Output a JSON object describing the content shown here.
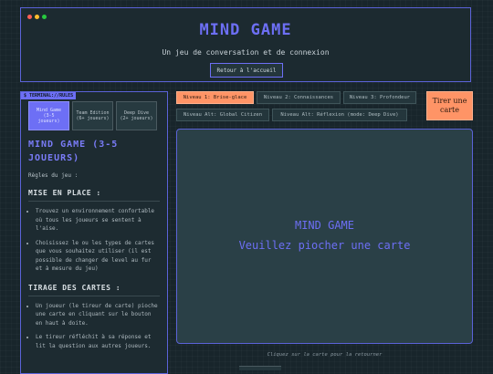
{
  "window": {
    "dots": [
      "#ff5f56",
      "#ffbd2e",
      "#27c93f"
    ]
  },
  "header": {
    "title": "MIND GAME",
    "subtitle": "Un jeu de conversation et de connexion",
    "home_button": "Retour à l'accueil"
  },
  "sidebar": {
    "terminal_label": "$ TERMINAL://RULES",
    "modes": [
      {
        "label": "Mind Game (3-5 joueurs)",
        "active": true
      },
      {
        "label": "Team Edition (6+ joueurs)",
        "active": false
      },
      {
        "label": "Deep Dive (2+ joueurs)",
        "active": false
      }
    ],
    "title": "MIND GAME (3-5 JOUEURS)",
    "rules_intro": "Règles du jeu :",
    "sections": [
      {
        "heading": "MISE EN PLACE :",
        "items": [
          "Trouvez un environnement confortable où tous les joueurs se sentent à l'aise.",
          "Choisissez le ou les types de cartes que vous souhaitez utiliser (il est possible de changer de level au fur et à mesure du jeu)"
        ]
      },
      {
        "heading": "TIRAGE DES CARTES :",
        "items": [
          "Un joueur (le tireur de carte) pioche une carte en cliquant sur le bouton en haut à doite.",
          "Le tireur réfléchit à sa réponse et lit la question aux autres joueurs."
        ]
      }
    ]
  },
  "levels": [
    {
      "label": "Niveau 1: Brise-glace",
      "active": true
    },
    {
      "label": "Niveau 2: Connaissances",
      "active": false
    },
    {
      "label": "Niveau 3: Profondeur",
      "active": false
    },
    {
      "label": "Niveau Alt: Global Citizen",
      "active": false
    },
    {
      "label": "Niveau Alt: Réflexion (mode: Deep Dive)",
      "active": false
    }
  ],
  "draw_button": "Tirer une carte",
  "card": {
    "title": "MIND GAME",
    "text": "Veuillez piocher une carte"
  },
  "hint": "Cliquez sur la carte pour la retourner"
}
